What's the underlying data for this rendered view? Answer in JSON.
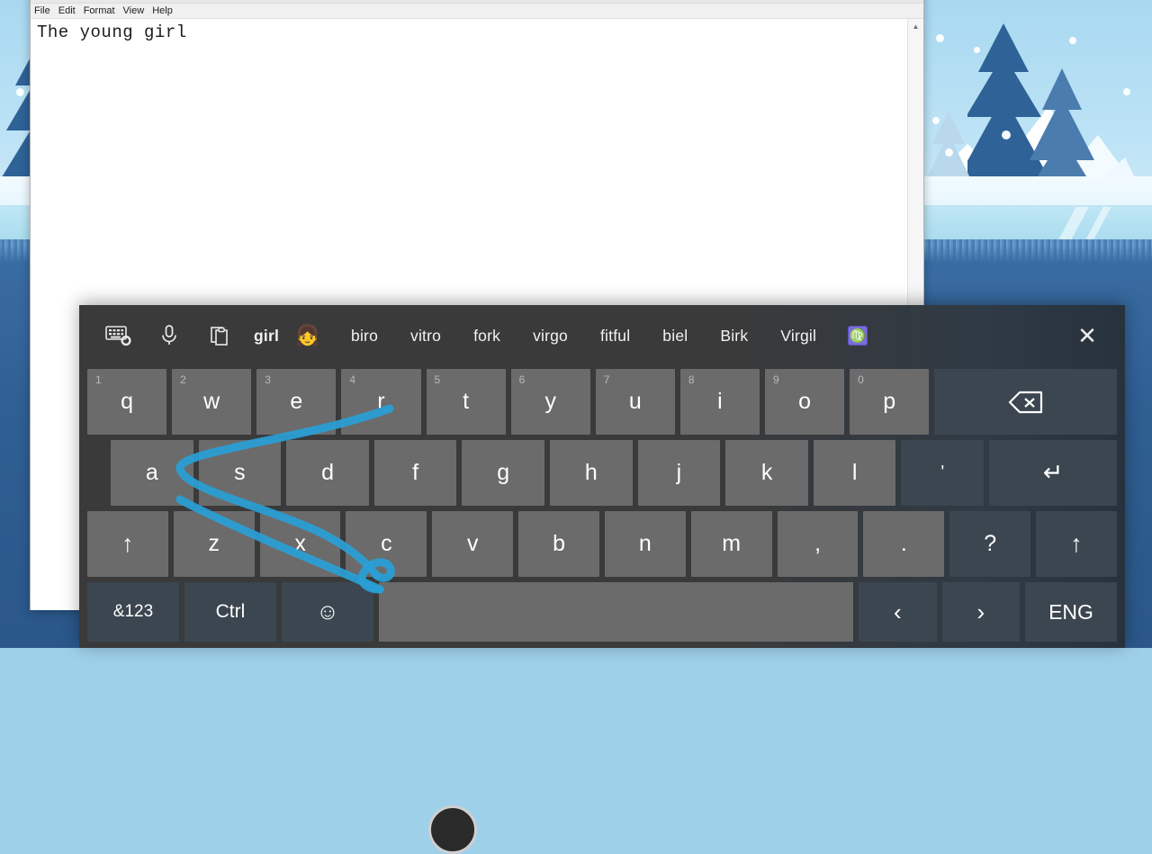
{
  "desktop": {
    "wallpaper_name": "winter-landscape-wallpaper",
    "colors": {
      "sky": "#a8d8f0",
      "snow": "#ffffff",
      "tree_dark": "#2f6296",
      "tree_light": "#6f9bc4",
      "water": "#2f5f93",
      "ice": "#bfe6f4"
    }
  },
  "notepad": {
    "menu": [
      "File",
      "Edit",
      "Format",
      "View",
      "Help"
    ],
    "document_text": "The young girl",
    "scroll_up_glyph": "▲"
  },
  "keyboard": {
    "suggestion_bar": {
      "icons": [
        {
          "name": "keyboard-settings-icon",
          "glyph": "keyboard-gear"
        },
        {
          "name": "microphone-icon",
          "glyph": "mic"
        },
        {
          "name": "clipboard-icon",
          "glyph": "clipboard"
        }
      ],
      "active_word": "girl",
      "emoji_suggestion": "👧",
      "words": [
        "biro",
        "vitro",
        "fork",
        "virgo",
        "fitful",
        "biel",
        "Birk",
        "Virgil"
      ],
      "zodiac_chip": {
        "name": "virgo-emoji-chip",
        "glyph": "♍",
        "color": "#7b6ddb"
      },
      "close_label": "✕"
    },
    "row1": [
      {
        "num": "1",
        "label": "q"
      },
      {
        "num": "2",
        "label": "w"
      },
      {
        "num": "3",
        "label": "e"
      },
      {
        "num": "4",
        "label": "r"
      },
      {
        "num": "5",
        "label": "t"
      },
      {
        "num": "6",
        "label": "y"
      },
      {
        "num": "7",
        "label": "u"
      },
      {
        "num": "8",
        "label": "i"
      },
      {
        "num": "9",
        "label": "o"
      },
      {
        "num": "0",
        "label": "p"
      }
    ],
    "backspace_label": "⌫",
    "row2": [
      "a",
      "s",
      "d",
      "f",
      "g",
      "h",
      "j",
      "k",
      "l",
      "'"
    ],
    "enter_label": "↵",
    "row3_shift_left": "↑",
    "row3": [
      "z",
      "x",
      "c",
      "v",
      "b",
      "n",
      "m",
      ",",
      "."
    ],
    "row3_question": "?",
    "row3_shift_right": "↑",
    "row4": {
      "numbers_label": "&123",
      "ctrl_label": "Ctrl",
      "emoji_label": "☺",
      "space_label": "",
      "left_label": "‹",
      "right_label": "›",
      "language_label": "ENG"
    },
    "swipe_trail_color": "#2a9fd6"
  }
}
